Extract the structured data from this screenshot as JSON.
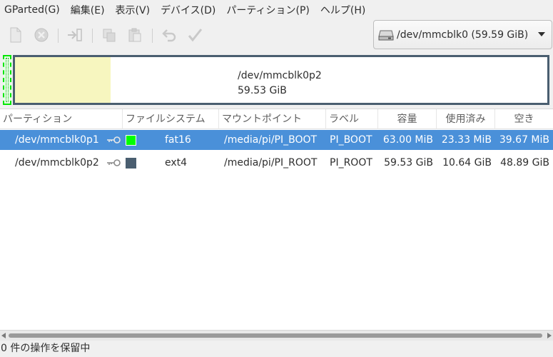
{
  "menu": [
    {
      "label": "GParted(G)"
    },
    {
      "label": "編集(E)"
    },
    {
      "label": "表示(V)"
    },
    {
      "label": "デバイス(D)"
    },
    {
      "label": "パーティション(P)"
    },
    {
      "label": "ヘルプ(H)"
    }
  ],
  "toolbar": {
    "buttons": [
      {
        "icon": "new-partition-icon",
        "enabled": false
      },
      {
        "icon": "delete-icon",
        "enabled": false
      },
      {
        "icon": "resize-move-icon",
        "enabled": false
      },
      {
        "icon": "copy-icon",
        "enabled": false
      },
      {
        "icon": "paste-icon",
        "enabled": false
      },
      {
        "icon": "undo-icon",
        "enabled": false
      },
      {
        "icon": "apply-icon",
        "enabled": false
      }
    ],
    "device_selector": {
      "label": "/dev/mmcblk0  (59.59 GiB)",
      "icon": "drive-icon"
    }
  },
  "partition_map": {
    "p1": {
      "name": "/dev/mmcblk0p1",
      "color": "#00e600"
    },
    "p2": {
      "name": "/dev/mmcblk0p2",
      "size": "59.53 GiB",
      "used_fraction": 0.18,
      "border_color": "#4a5e70",
      "used_color": "#f7f6bf"
    }
  },
  "table": {
    "headers": [
      "パーティション",
      "ファイルシステム",
      "マウントポイント",
      "ラベル",
      "容量",
      "使用済み",
      "空き"
    ],
    "rows": [
      {
        "partition": "/dev/mmcblk0p1",
        "mounted_icon": "key-icon",
        "fs_color": "#00ff00",
        "filesystem": "fat16",
        "mount": "/media/pi/PI_BOOT",
        "label": "PI_BOOT",
        "size": "63.00 MiB",
        "used": "23.33 MiB",
        "free": "39.67 MiB",
        "selected": true
      },
      {
        "partition": "/dev/mmcblk0p2",
        "mounted_icon": "key-icon",
        "fs_color": "#4a5e70",
        "filesystem": "ext4",
        "mount": "/media/pi/PI_ROOT",
        "label": "PI_ROOT",
        "size": "59.53 GiB",
        "used": "10.64 GiB",
        "free": "48.89 GiB",
        "selected": false
      }
    ]
  },
  "statusbar": {
    "text": "0 件の操作を保留中"
  },
  "colors": {
    "selection": "#4a90d9",
    "background": "#f0f0f0"
  }
}
